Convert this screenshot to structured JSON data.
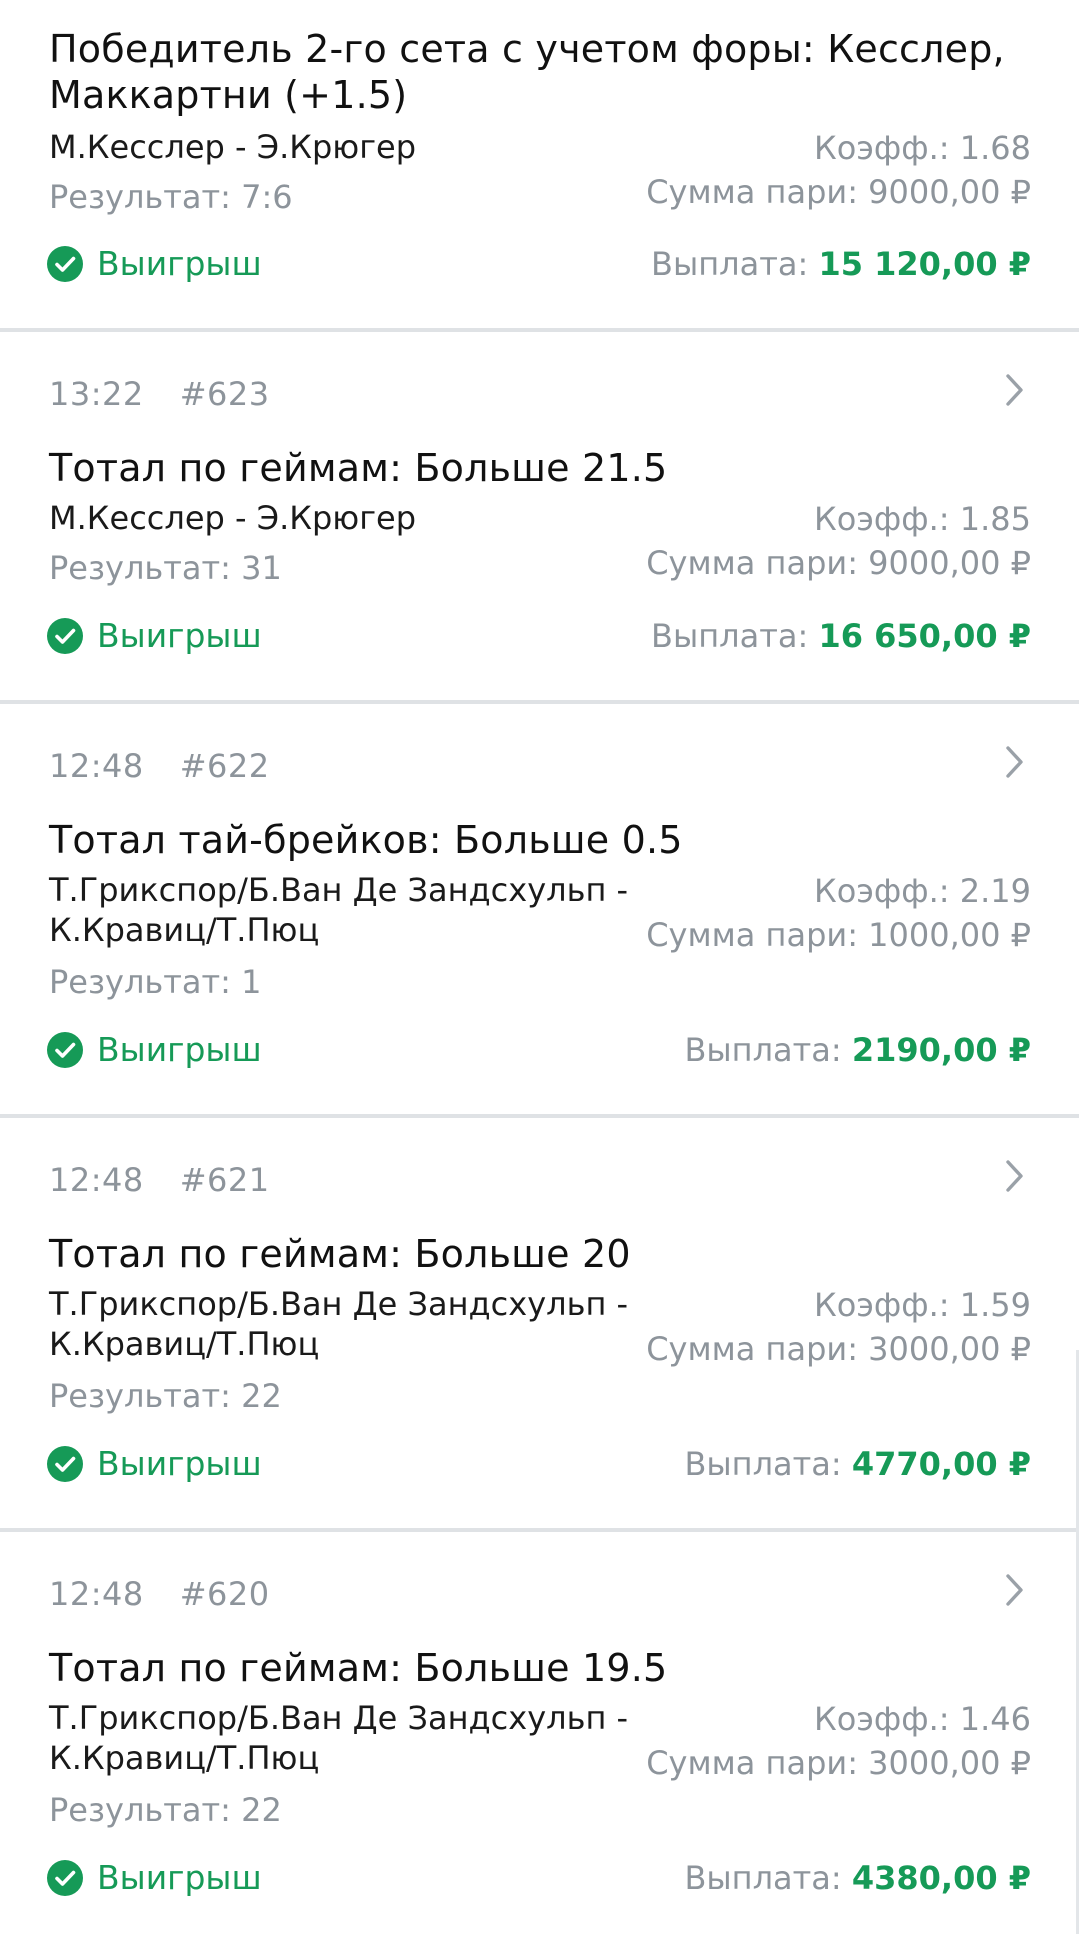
{
  "bets": [
    {
      "time": "",
      "number": "",
      "title_lines": [
        "Победитель 2-го сета с учетом форы: Кесслер,",
        "Маккартни (+1.5)"
      ],
      "event_lines": [
        "М.Кесслер - Э.Крюгер"
      ],
      "result": "Результат: 7:6",
      "coef": "Коэфф.: 1.68",
      "stake": "Сумма пари: 9000,00 ₽",
      "status": "Выигрыш",
      "payout_label": "Выплата:",
      "payout_amount": "15 120,00 ₽"
    },
    {
      "time": "13:22",
      "number": "#623",
      "title_lines": [
        "Тотал по геймам: Больше 21.5"
      ],
      "event_lines": [
        "М.Кесслер - Э.Крюгер"
      ],
      "result": "Результат: 31",
      "coef": "Коэфф.: 1.85",
      "stake": "Сумма пари: 9000,00 ₽",
      "status": "Выигрыш",
      "payout_label": "Выплата:",
      "payout_amount": "16 650,00 ₽"
    },
    {
      "time": "12:48",
      "number": "#622",
      "title_lines": [
        "Тотал тай-брейков: Больше 0.5"
      ],
      "event_lines": [
        "Т.Грикспор/Б.Ван Де Зандсхульп -",
        "К.Кравиц/Т.Пюц"
      ],
      "result": "Результат: 1",
      "coef": "Коэфф.: 2.19",
      "stake": "Сумма пари: 1000,00 ₽",
      "status": "Выигрыш",
      "payout_label": "Выплата:",
      "payout_amount": "2190,00 ₽"
    },
    {
      "time": "12:48",
      "number": "#621",
      "title_lines": [
        "Тотал по геймам: Больше 20"
      ],
      "event_lines": [
        "Т.Грикспор/Б.Ван Де Зандсхульп -",
        "К.Кравиц/Т.Пюц"
      ],
      "result": "Результат: 22",
      "coef": "Коэфф.: 1.59",
      "stake": "Сумма пари: 3000,00 ₽",
      "status": "Выигрыш",
      "payout_label": "Выплата:",
      "payout_amount": "4770,00 ₽"
    },
    {
      "time": "12:48",
      "number": "#620",
      "title_lines": [
        "Тотал по геймам: Больше 19.5"
      ],
      "event_lines": [
        "Т.Грикспор/Б.Ван Де Зандсхульп -",
        "К.Кравиц/Т.Пюц"
      ],
      "result": "Результат: 22",
      "coef": "Коэфф.: 1.46",
      "stake": "Сумма пари: 3000,00 ₽",
      "status": "Выигрыш",
      "payout_label": "Выплата:",
      "payout_amount": "4380,00 ₽"
    }
  ],
  "icons": {
    "status_icon": "check-circle-icon",
    "open_icon": "chevron-right-icon"
  },
  "colors": {
    "win_green": "#169a57",
    "muted_gray": "#8d949b",
    "divider": "#dfe2e5"
  }
}
